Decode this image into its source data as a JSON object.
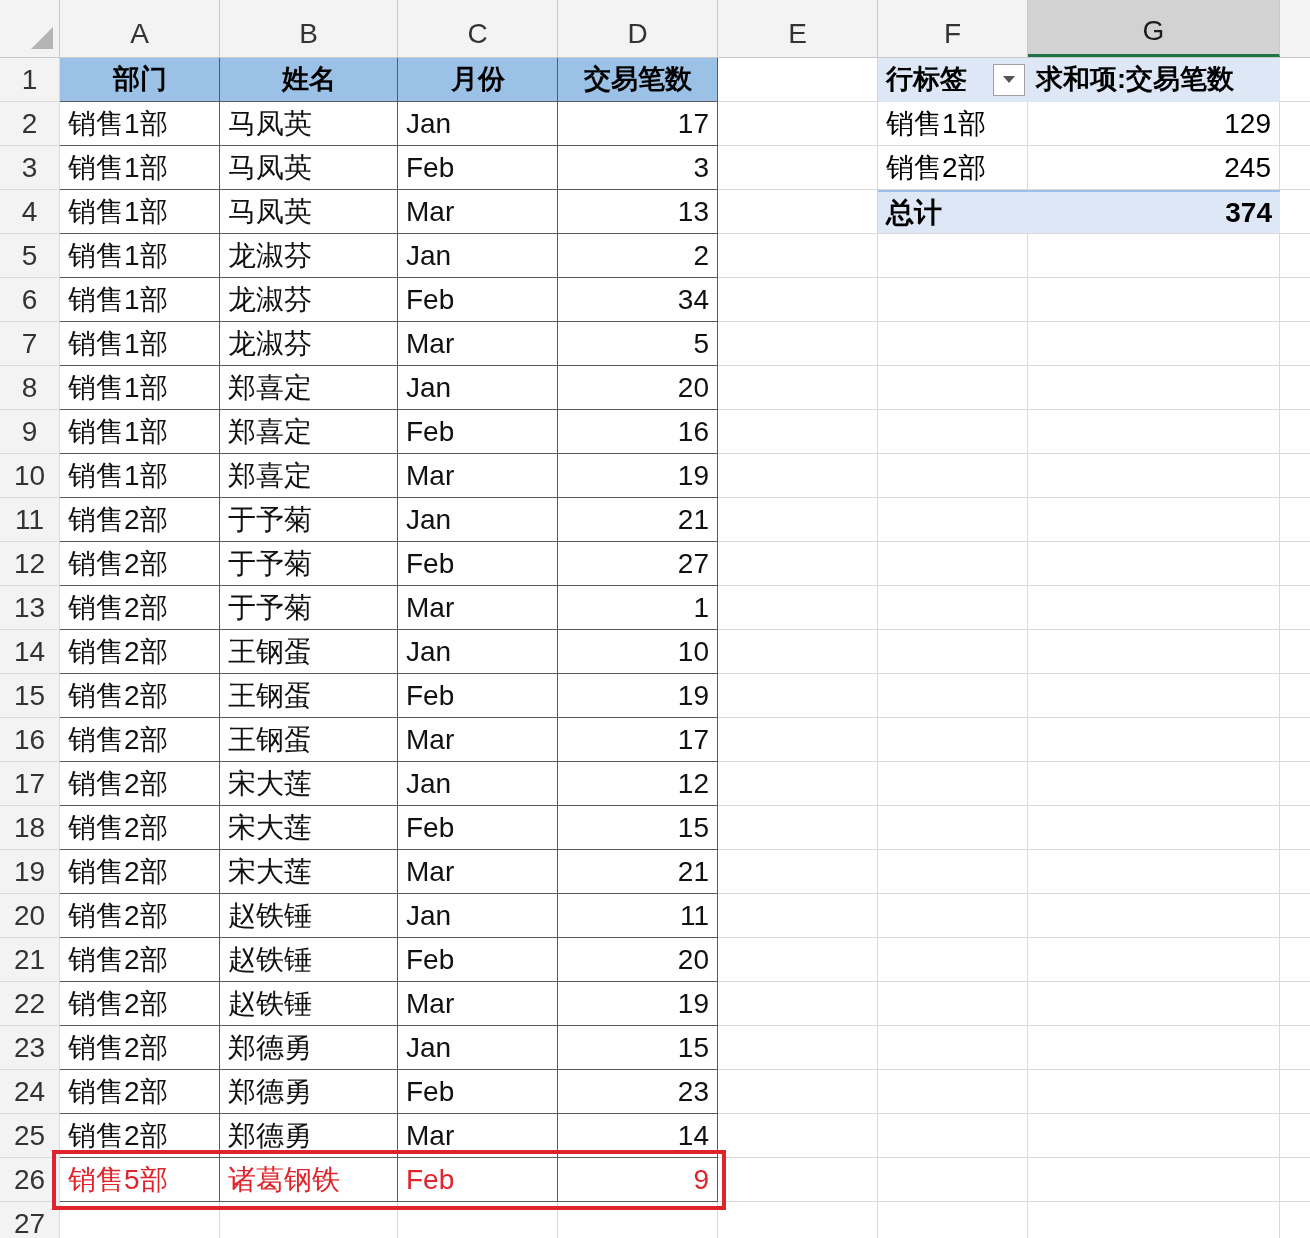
{
  "columns": [
    {
      "label": "A",
      "selected": false
    },
    {
      "label": "B",
      "selected": false
    },
    {
      "label": "C",
      "selected": false
    },
    {
      "label": "D",
      "selected": false
    },
    {
      "label": "E",
      "selected": false
    },
    {
      "label": "F",
      "selected": false
    },
    {
      "label": "G",
      "selected": true
    }
  ],
  "row_numbers": [
    "1",
    "2",
    "3",
    "4",
    "5",
    "6",
    "7",
    "8",
    "9",
    "10",
    "11",
    "12",
    "13",
    "14",
    "15",
    "16",
    "17",
    "18",
    "19",
    "20",
    "21",
    "22",
    "23",
    "24",
    "25",
    "26",
    "27"
  ],
  "table": {
    "header": [
      "部门",
      "姓名",
      "月份",
      "交易笔数"
    ],
    "rows": [
      {
        "cells": [
          "销售1部",
          "马凤英",
          "Jan",
          "17"
        ],
        "highlighted": false
      },
      {
        "cells": [
          "销售1部",
          "马凤英",
          "Feb",
          "3"
        ],
        "highlighted": false
      },
      {
        "cells": [
          "销售1部",
          "马凤英",
          "Mar",
          "13"
        ],
        "highlighted": false
      },
      {
        "cells": [
          "销售1部",
          "龙淑芬",
          "Jan",
          "2"
        ],
        "highlighted": false
      },
      {
        "cells": [
          "销售1部",
          "龙淑芬",
          "Feb",
          "34"
        ],
        "highlighted": false
      },
      {
        "cells": [
          "销售1部",
          "龙淑芬",
          "Mar",
          "5"
        ],
        "highlighted": false
      },
      {
        "cells": [
          "销售1部",
          "郑喜定",
          "Jan",
          "20"
        ],
        "highlighted": false
      },
      {
        "cells": [
          "销售1部",
          "郑喜定",
          "Feb",
          "16"
        ],
        "highlighted": false
      },
      {
        "cells": [
          "销售1部",
          "郑喜定",
          "Mar",
          "19"
        ],
        "highlighted": false
      },
      {
        "cells": [
          "销售2部",
          "于予菊",
          "Jan",
          "21"
        ],
        "highlighted": false
      },
      {
        "cells": [
          "销售2部",
          "于予菊",
          "Feb",
          "27"
        ],
        "highlighted": false
      },
      {
        "cells": [
          "销售2部",
          "于予菊",
          "Mar",
          "1"
        ],
        "highlighted": false
      },
      {
        "cells": [
          "销售2部",
          "王钢蛋",
          "Jan",
          "10"
        ],
        "highlighted": false
      },
      {
        "cells": [
          "销售2部",
          "王钢蛋",
          "Feb",
          "19"
        ],
        "highlighted": false
      },
      {
        "cells": [
          "销售2部",
          "王钢蛋",
          "Mar",
          "17"
        ],
        "highlighted": false
      },
      {
        "cells": [
          "销售2部",
          "宋大莲",
          "Jan",
          "12"
        ],
        "highlighted": false
      },
      {
        "cells": [
          "销售2部",
          "宋大莲",
          "Feb",
          "15"
        ],
        "highlighted": false
      },
      {
        "cells": [
          "销售2部",
          "宋大莲",
          "Mar",
          "21"
        ],
        "highlighted": false
      },
      {
        "cells": [
          "销售2部",
          "赵铁锤",
          "Jan",
          "11"
        ],
        "highlighted": false
      },
      {
        "cells": [
          "销售2部",
          "赵铁锤",
          "Feb",
          "20"
        ],
        "highlighted": false
      },
      {
        "cells": [
          "销售2部",
          "赵铁锤",
          "Mar",
          "19"
        ],
        "highlighted": false
      },
      {
        "cells": [
          "销售2部",
          "郑德勇",
          "Jan",
          "15"
        ],
        "highlighted": false
      },
      {
        "cells": [
          "销售2部",
          "郑德勇",
          "Feb",
          "23"
        ],
        "highlighted": false
      },
      {
        "cells": [
          "销售2部",
          "郑德勇",
          "Mar",
          "14"
        ],
        "highlighted": false
      },
      {
        "cells": [
          "销售5部",
          "诸葛钢铁",
          "Feb",
          "9"
        ],
        "highlighted": true
      }
    ]
  },
  "pivot": {
    "row_label": "行标签",
    "value_label": "求和项:交易笔数",
    "rows": [
      {
        "label": "销售1部",
        "value": "129",
        "total": false
      },
      {
        "label": "销售2部",
        "value": "245",
        "total": false
      },
      {
        "label": "总计",
        "value": "374",
        "total": true
      }
    ]
  }
}
